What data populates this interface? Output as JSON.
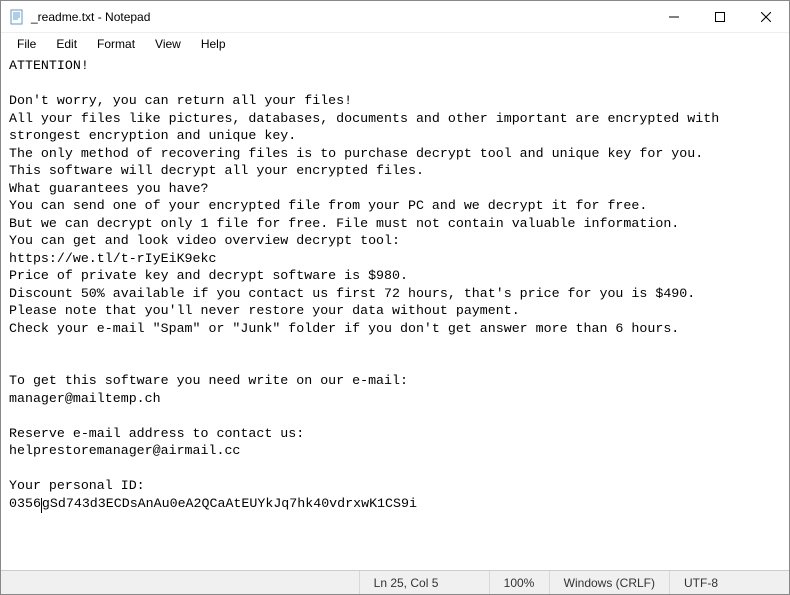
{
  "window": {
    "title": "_readme.txt - Notepad"
  },
  "menu": {
    "file": "File",
    "edit": "Edit",
    "format": "Format",
    "view": "View",
    "help": "Help"
  },
  "body": {
    "text_before_caret": "ATTENTION!\n\nDon't worry, you can return all your files!\nAll your files like pictures, databases, documents and other important are encrypted with strongest encryption and unique key.\nThe only method of recovering files is to purchase decrypt tool and unique key for you.\nThis software will decrypt all your encrypted files.\nWhat guarantees you have?\nYou can send one of your encrypted file from your PC and we decrypt it for free.\nBut we can decrypt only 1 file for free. File must not contain valuable information.\nYou can get and look video overview decrypt tool:\nhttps://we.tl/t-rIyEiK9ekc\nPrice of private key and decrypt software is $980.\nDiscount 50% available if you contact us first 72 hours, that's price for you is $490.\nPlease note that you'll never restore your data without payment.\nCheck your e-mail \"Spam\" or \"Junk\" folder if you don't get answer more than 6 hours.\n\n\nTo get this software you need write on our e-mail:\nmanager@mailtemp.ch\n\nReserve e-mail address to contact us:\nhelprestoremanager@airmail.cc\n\nYour personal ID:\n0356",
    "text_after_caret": "gSd743d3ECDsAnAu0eA2QCaAtEUYkJq7hk40vdrxwK1CS9i"
  },
  "status": {
    "position": "Ln 25, Col 5",
    "zoom": "100%",
    "line_ending": "Windows (CRLF)",
    "encoding": "UTF-8"
  }
}
